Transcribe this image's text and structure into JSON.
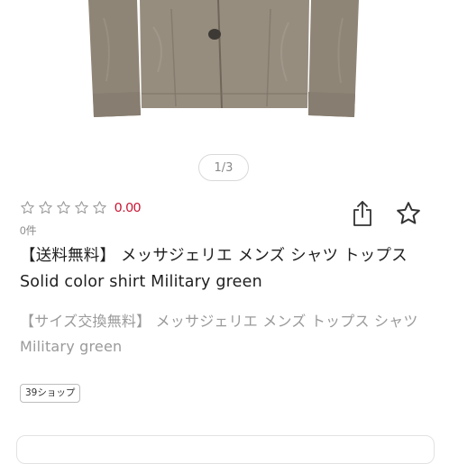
{
  "product": {
    "image_pager": "1/3",
    "rating_value": "0.00",
    "rating_stars": 0,
    "review_count": "0件",
    "title": "【送料無料】 メッサジェリエ メンズ シャツ トップス Solid color shirt Military green",
    "subtitle": "【サイズ交換無料】 メッサジェリエ メンズ トップス シャツ Military green",
    "shop_tag": "39ショップ"
  },
  "colors": {
    "rating": "#c8102e",
    "star_outline": "#9a9a9a",
    "jacket": "#8f8577",
    "text_main": "#1f1f1f",
    "text_sub": "#9a9a9a"
  },
  "icons": {
    "share": "share-icon",
    "favorite": "star-outline-icon"
  }
}
